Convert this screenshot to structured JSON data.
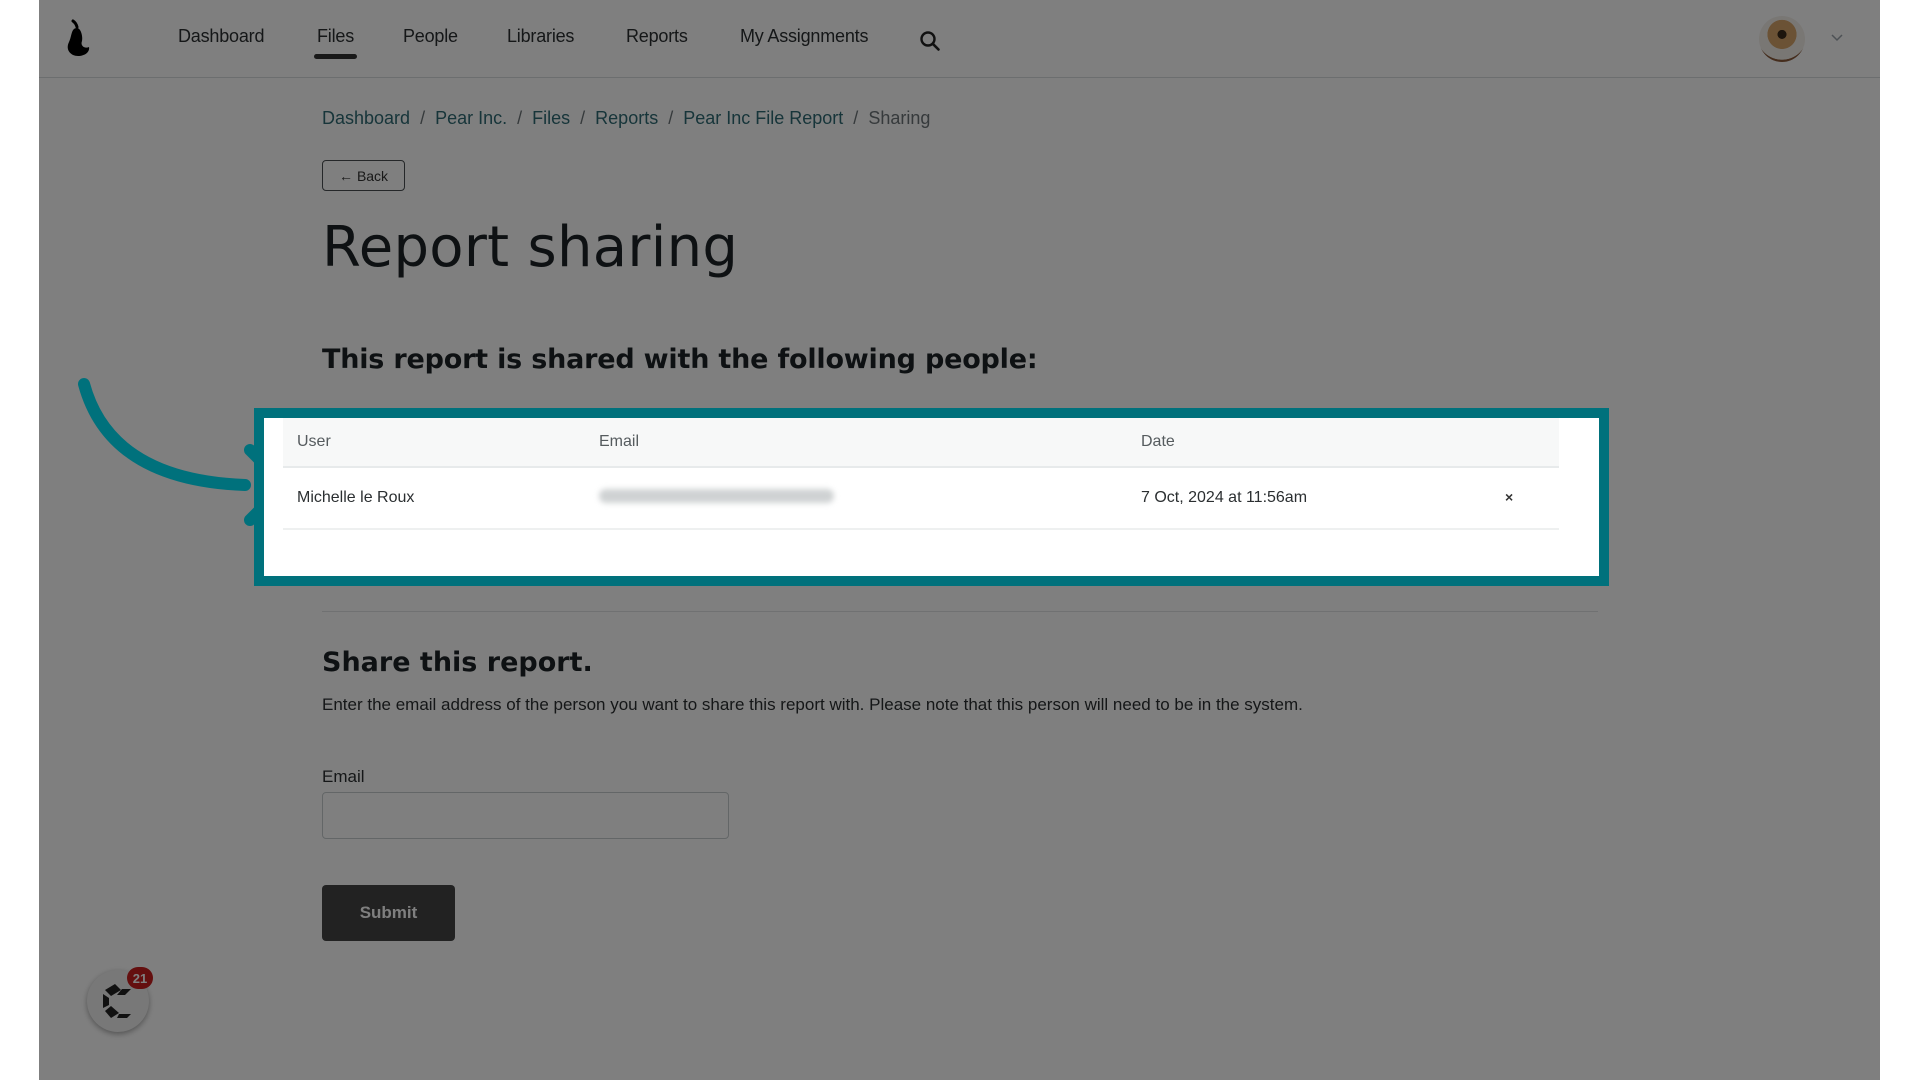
{
  "nav": {
    "items": [
      {
        "label": "Dashboard",
        "active": false
      },
      {
        "label": "Files",
        "active": true
      },
      {
        "label": "People",
        "active": false
      },
      {
        "label": "Libraries",
        "active": false
      },
      {
        "label": "Reports",
        "active": false
      },
      {
        "label": "My Assignments",
        "active": false
      }
    ],
    "search_icon": "search-icon",
    "avatar_icon": "user-avatar",
    "caret_icon": "chevron-down-icon"
  },
  "breadcrumb": {
    "items": [
      "Dashboard",
      "Pear Inc.",
      "Files",
      "Reports",
      "Pear Inc File Report"
    ],
    "current": "Sharing",
    "separator": "/"
  },
  "back_button": {
    "arrow": "←",
    "label": "Back"
  },
  "page_title": "Report sharing",
  "shared_section": {
    "heading": "This report is shared with the following people:",
    "columns": [
      "User",
      "Email",
      "Date"
    ],
    "rows": [
      {
        "user": "Michelle le Roux",
        "email": "[redacted]",
        "date": "7 Oct, 2024 at 11:56am",
        "remove": "×"
      }
    ]
  },
  "share_form": {
    "heading": "Share this report.",
    "description": "Enter the email address of the person you want to share this report with. Please note that this person will need to be in the system.",
    "email_label": "Email",
    "email_value": "",
    "email_placeholder": "",
    "submit_label": "Submit"
  },
  "chat_widget": {
    "badge_count": "21"
  },
  "colors": {
    "highlight": "#00717c",
    "link": "#2e6b74",
    "submit": "#454545",
    "badge": "#c81e1e"
  }
}
